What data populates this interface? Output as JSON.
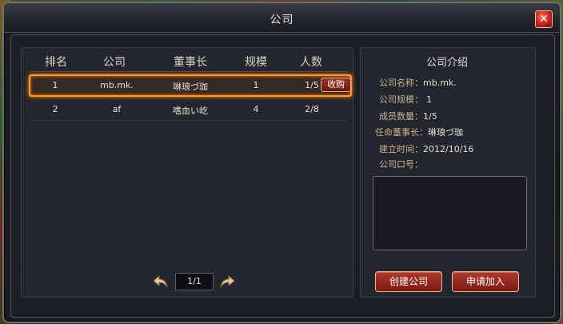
{
  "window": {
    "title": "公司",
    "close_label": "✕"
  },
  "table": {
    "headers": {
      "rank": "排名",
      "company": "公司",
      "chairman": "董事长",
      "scale": "规模",
      "members": "人数"
    },
    "rows": [
      {
        "rank": "1",
        "company": "mb.mk.",
        "chairman": "琳琅づ珈",
        "scale": "1",
        "members": "1/5",
        "action": "收购"
      },
      {
        "rank": "2",
        "company": "af",
        "chairman": "嗜血い屹",
        "scale": "4",
        "members": "2/8"
      }
    ],
    "pager": {
      "page": "1/1"
    }
  },
  "intro": {
    "title": "公司介绍",
    "name_label": "公司名称：",
    "name_value": "mb.mk.",
    "scale_label": "公司规模：",
    "scale_value": "1",
    "members_label": "成员数量：",
    "members_value": "1/5",
    "chairman_label": "任命董事长：",
    "chairman_value": "琳琅づ珈",
    "founded_label": "建立时间：",
    "founded_value": "2012/10/16",
    "slogan_label": "公司口号：",
    "slogan_value": ""
  },
  "buttons": {
    "create": "创建公司",
    "apply": "申请加入"
  },
  "icons": {
    "prev": "undo-arrow-icon",
    "next": "redo-arrow-icon",
    "close": "close-icon"
  },
  "colors": {
    "accent": "#ff9a1a",
    "button_red": "#b23a2c",
    "label_gold": "#c8b48c"
  }
}
